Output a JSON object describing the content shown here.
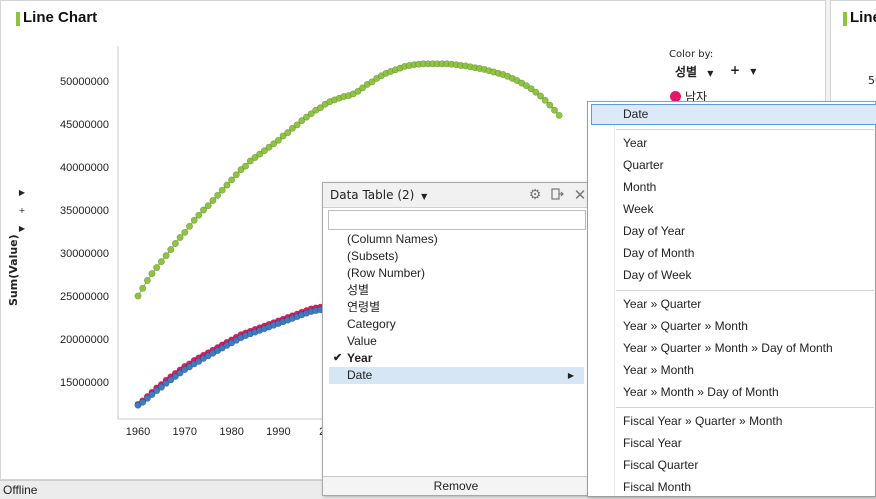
{
  "main_panel": {
    "title": "Line Chart"
  },
  "right_panel": {
    "title": "Line",
    "partial_tick": "50"
  },
  "side_controls": [
    "▶",
    "+",
    "▶"
  ],
  "color_by": {
    "label": "Color by:",
    "column": "성별",
    "add": "+",
    "legend_item": "남자",
    "legend_color": "#e3186b"
  },
  "chart_data": {
    "type": "line",
    "ylabel": "Sum(Value)",
    "y_ticks": [
      "50000000",
      "45000000",
      "40000000",
      "35000000",
      "30000000",
      "25000000",
      "20000000",
      "15000000"
    ],
    "x_ticks": [
      "1960",
      "1970",
      "1980",
      "1990",
      "20"
    ],
    "ylim": [
      11000000,
      53500000
    ],
    "xlim": [
      1958,
      2050
    ],
    "series": [
      {
        "color": "#8ec43f",
        "x": [
          1960,
          1961,
          1962,
          1963,
          1964,
          1965,
          1966,
          1967,
          1968,
          1969,
          1970,
          1971,
          1972,
          1973,
          1974,
          1975,
          1976,
          1977,
          1978,
          1979,
          1980,
          1981,
          1982,
          1983,
          1984,
          1985,
          1986,
          1987,
          1988,
          1989,
          1990,
          1991,
          1992,
          1993,
          1994,
          1995,
          1996,
          1997,
          1998,
          1999,
          2000,
          2001,
          2002,
          2003,
          2004,
          2005,
          2006,
          2007,
          2008,
          2009,
          2010,
          2011,
          2012,
          2013,
          2014,
          2015,
          2016,
          2017,
          2018,
          2019,
          2020,
          2021,
          2022,
          2023,
          2024,
          2025,
          2026,
          2027,
          2028,
          2029,
          2030,
          2031,
          2032,
          2033,
          2034,
          2035,
          2036,
          2037,
          2038,
          2039,
          2040,
          2041,
          2042,
          2043,
          2044,
          2045,
          2046,
          2047,
          2048,
          2049,
          2050
        ],
        "values": [
          25000000,
          25900000,
          26800000,
          27600000,
          28300000,
          29000000,
          29700000,
          30400000,
          31100000,
          31800000,
          32400000,
          33100000,
          33800000,
          34400000,
          35000000,
          35500000,
          36100000,
          36700000,
          37300000,
          37900000,
          38500000,
          39100000,
          39700000,
          40100000,
          40700000,
          41100000,
          41500000,
          41900000,
          42300000,
          42700000,
          43100000,
          43600000,
          44000000,
          44500000,
          44900000,
          45400000,
          45800000,
          46200000,
          46600000,
          46900000,
          47300000,
          47600000,
          47800000,
          48000000,
          48200000,
          48300000,
          48500000,
          48800000,
          49200000,
          49600000,
          49900000,
          50300000,
          50600000,
          50900000,
          51100000,
          51300000,
          51500000,
          51700000,
          51800000,
          51900000,
          51950000,
          52000000,
          52000000,
          52000000,
          52000000,
          52000000,
          52000000,
          51950000,
          51900000,
          51800000,
          51750000,
          51650000,
          51550000,
          51450000,
          51350000,
          51200000,
          51050000,
          50900000,
          50750000,
          50550000,
          50300000,
          50050000,
          49750000,
          49450000,
          49100000,
          48700000,
          48250000,
          47750000,
          47200000,
          46600000,
          46000000
        ]
      },
      {
        "color": "#e3186b",
        "x": [
          1960,
          1961,
          1962,
          1963,
          1964,
          1965,
          1966,
          1967,
          1968,
          1969,
          1970,
          1971,
          1972,
          1973,
          1974,
          1975,
          1976,
          1977,
          1978,
          1979,
          1980,
          1981,
          1982,
          1983,
          1984,
          1985,
          1986,
          1987,
          1988,
          1989,
          1990,
          1991,
          1992,
          1993,
          1994,
          1995,
          1996,
          1997,
          1998,
          1999,
          2000,
          2001,
          2002,
          2003
        ],
        "values": [
          12400000,
          12800000,
          13300000,
          13800000,
          14300000,
          14700000,
          15200000,
          15600000,
          16000000,
          16400000,
          16800000,
          17100000,
          17500000,
          17800000,
          18100000,
          18400000,
          18700000,
          19000000,
          19300000,
          19600000,
          19900000,
          20200000,
          20500000,
          20700000,
          20900000,
          21100000,
          21300000,
          21500000,
          21700000,
          21900000,
          22100000,
          22300000,
          22500000,
          22700000,
          22900000,
          23100000,
          23300000,
          23500000,
          23600000,
          23700000,
          23800000,
          23900000,
          24000000,
          24100000
        ]
      },
      {
        "color": "#3d7cbf",
        "x": [
          1960,
          1961,
          1962,
          1963,
          1964,
          1965,
          1966,
          1967,
          1968,
          1969,
          1970,
          1971,
          1972,
          1973,
          1974,
          1975,
          1976,
          1977,
          1978,
          1979,
          1980,
          1981,
          1982,
          1983,
          1984,
          1985,
          1986,
          1987,
          1988,
          1989,
          1990,
          1991,
          1992,
          1993,
          1994,
          1995,
          1996,
          1997,
          1998,
          1999,
          2000,
          2001,
          2002,
          2003
        ],
        "values": [
          12300000,
          12650000,
          13100000,
          13550000,
          14000000,
          14400000,
          14850000,
          15250000,
          15650000,
          16050000,
          16450000,
          16750000,
          17100000,
          17400000,
          17750000,
          18050000,
          18350000,
          18650000,
          18950000,
          19250000,
          19550000,
          19850000,
          20150000,
          20400000,
          20600000,
          20800000,
          21000000,
          21200000,
          21400000,
          21600000,
          21800000,
          22000000,
          22200000,
          22400000,
          22600000,
          22800000,
          23000000,
          23200000,
          23300000,
          23400000,
          23500000,
          23600000,
          23700000,
          23800000
        ]
      }
    ]
  },
  "data_table_popup": {
    "title": "Data Table (2)",
    "items": [
      {
        "label": "(Column Names)"
      },
      {
        "label": "(Subsets)"
      },
      {
        "label": "(Row Number)"
      },
      {
        "label": "성별"
      },
      {
        "label": "연령별"
      },
      {
        "label": "Category"
      },
      {
        "label": "Value"
      },
      {
        "label": "Year",
        "checked": true,
        "bold": true
      },
      {
        "label": "Date",
        "selected": true,
        "submenu": true
      }
    ],
    "check_glyph": "✔",
    "arrow_glyph": "▶",
    "remove_label": "Remove"
  },
  "submenu": {
    "items": [
      {
        "label": "Date",
        "highlighted": true
      },
      {
        "sep": true
      },
      {
        "label": "Year"
      },
      {
        "label": "Quarter"
      },
      {
        "label": "Month"
      },
      {
        "label": "Week"
      },
      {
        "label": "Day of Year"
      },
      {
        "label": "Day of Month"
      },
      {
        "label": "Day of Week"
      },
      {
        "sep": true
      },
      {
        "label": "Year » Quarter"
      },
      {
        "label": "Year » Quarter » Month"
      },
      {
        "label": "Year » Quarter » Month » Day of Month"
      },
      {
        "label": "Year » Month"
      },
      {
        "label": "Year » Month » Day of Month"
      },
      {
        "sep": true
      },
      {
        "label": "Fiscal Year » Quarter » Month"
      },
      {
        "label": "Fiscal Year"
      },
      {
        "label": "Fiscal Quarter"
      },
      {
        "label": "Fiscal Month"
      }
    ]
  },
  "status_bar": {
    "text": "Offline"
  }
}
